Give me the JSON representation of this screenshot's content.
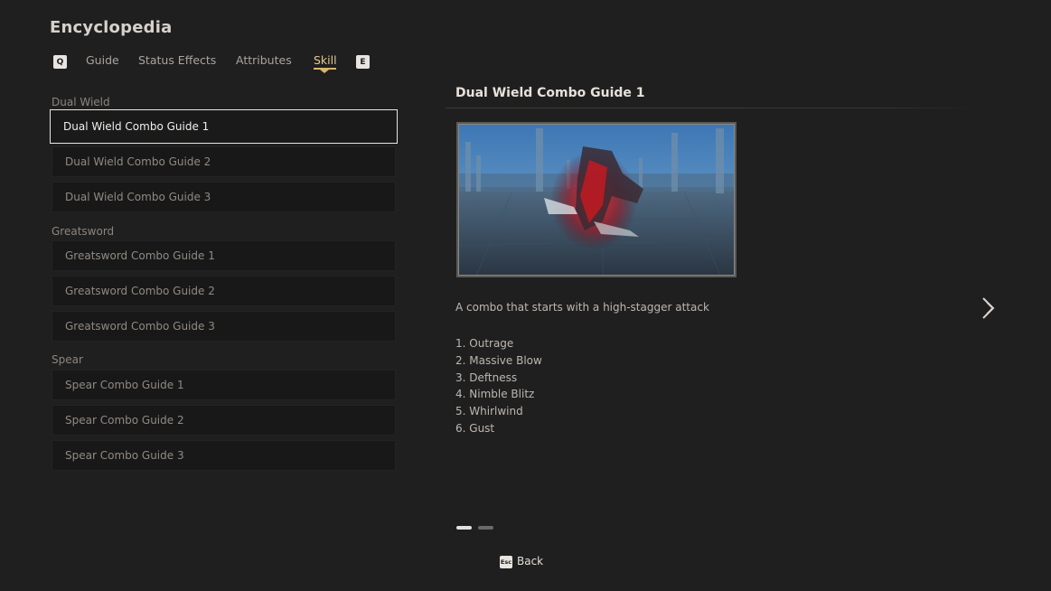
{
  "header": {
    "title": "Encyclopedia"
  },
  "tabs": {
    "prev_key": "Q",
    "next_key": "E",
    "items": [
      {
        "label": "Guide",
        "active": false
      },
      {
        "label": "Status Effects",
        "active": false
      },
      {
        "label": "Attributes",
        "active": false
      },
      {
        "label": "Skill",
        "active": true
      }
    ]
  },
  "sections": [
    {
      "label": "Dual Wield",
      "items": [
        "Dual Wield Combo Guide 1",
        "Dual Wield Combo Guide 2",
        "Dual Wield Combo Guide 3"
      ]
    },
    {
      "label": "Greatsword",
      "items": [
        "Greatsword Combo Guide 1",
        "Greatsword Combo Guide 2",
        "Greatsword Combo Guide 3"
      ]
    },
    {
      "label": "Spear",
      "items": [
        "Spear Combo Guide 1",
        "Spear Combo Guide 2",
        "Spear Combo Guide 3"
      ]
    }
  ],
  "selected_item": "Dual Wield Combo Guide 1",
  "detail": {
    "title": "Dual Wield Combo Guide 1",
    "description": "A combo that starts with a high-stagger attack",
    "steps": [
      "1. Outrage",
      "2. Massive Blow",
      "3. Deftness",
      "4. Nimble Blitz",
      "5. Whirlwind",
      "6. Gust"
    ]
  },
  "pager": {
    "page": 1,
    "total": 2
  },
  "footer": {
    "back_key": "Esc",
    "back_label": "Back"
  },
  "colors": {
    "background": "#201f1f",
    "accent": "#d9b66c",
    "selected_border": "#e9e6e1"
  },
  "icons": {
    "next": "chevron-right-icon",
    "preview": "combo-preview-image"
  }
}
